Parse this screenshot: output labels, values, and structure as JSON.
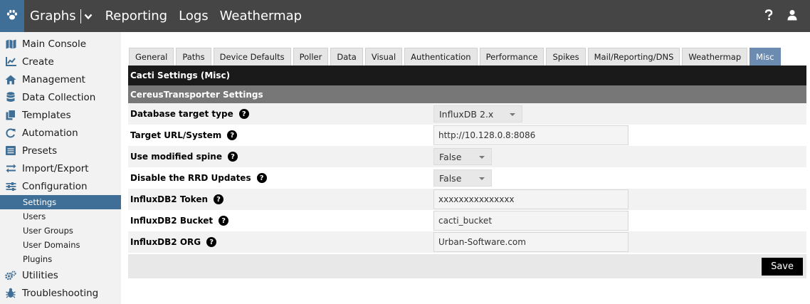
{
  "header": {
    "nav": {
      "graphs": "Graphs",
      "reporting": "Reporting",
      "logs": "Logs",
      "weathermap": "Weathermap"
    },
    "icons": {
      "logo": "paw-icon",
      "help": "help-icon",
      "user": "user-icon"
    },
    "colors": {
      "bar": "#454545",
      "logo_bg": "#3f6f96"
    }
  },
  "sidebar": {
    "items": [
      {
        "label": "Main Console",
        "icon": "map-icon"
      },
      {
        "label": "Create",
        "icon": "chart-icon"
      },
      {
        "label": "Management",
        "icon": "home-icon"
      },
      {
        "label": "Data Collection",
        "icon": "database-icon"
      },
      {
        "label": "Templates",
        "icon": "copy-icon"
      },
      {
        "label": "Automation",
        "icon": "refresh-icon"
      },
      {
        "label": "Presets",
        "icon": "list-icon"
      },
      {
        "label": "Import/Export",
        "icon": "exchange-icon"
      },
      {
        "label": "Configuration",
        "icon": "sliders-icon"
      }
    ],
    "subitems": [
      "Settings",
      "Users",
      "User Groups",
      "User Domains",
      "Plugins"
    ],
    "bottom_items": [
      {
        "label": "Utilities",
        "icon": "cogs-icon"
      },
      {
        "label": "Troubleshooting",
        "icon": "bug-icon"
      }
    ],
    "active_color": "#3f6f96"
  },
  "tabs": [
    "General",
    "Paths",
    "Device Defaults",
    "Poller",
    "Data",
    "Visual",
    "Authentication",
    "Performance",
    "Spikes",
    "Mail/Reporting/DNS",
    "Weathermap",
    "Misc"
  ],
  "active_tab": "Misc",
  "panel": {
    "title": "Cacti Settings (Misc)",
    "section": "CereusTransporter Settings",
    "fields": [
      {
        "label": "Database target type",
        "value": "InfluxDB 2.x"
      },
      {
        "label": "Target URL/System",
        "value": "http://10.128.0.8:8086"
      },
      {
        "label": "Use modified spine",
        "value": "False"
      },
      {
        "label": "Disable the RRD Updates",
        "value": "False"
      },
      {
        "label": "InfluxDB2 Token",
        "value": "xxxxxxxxxxxxxxx"
      },
      {
        "label": "InfluxDB2 Bucket",
        "value": "cacti_bucket"
      },
      {
        "label": "InfluxDB2 ORG",
        "value": "Urban-Software.com"
      }
    ],
    "save_label": "Save"
  }
}
